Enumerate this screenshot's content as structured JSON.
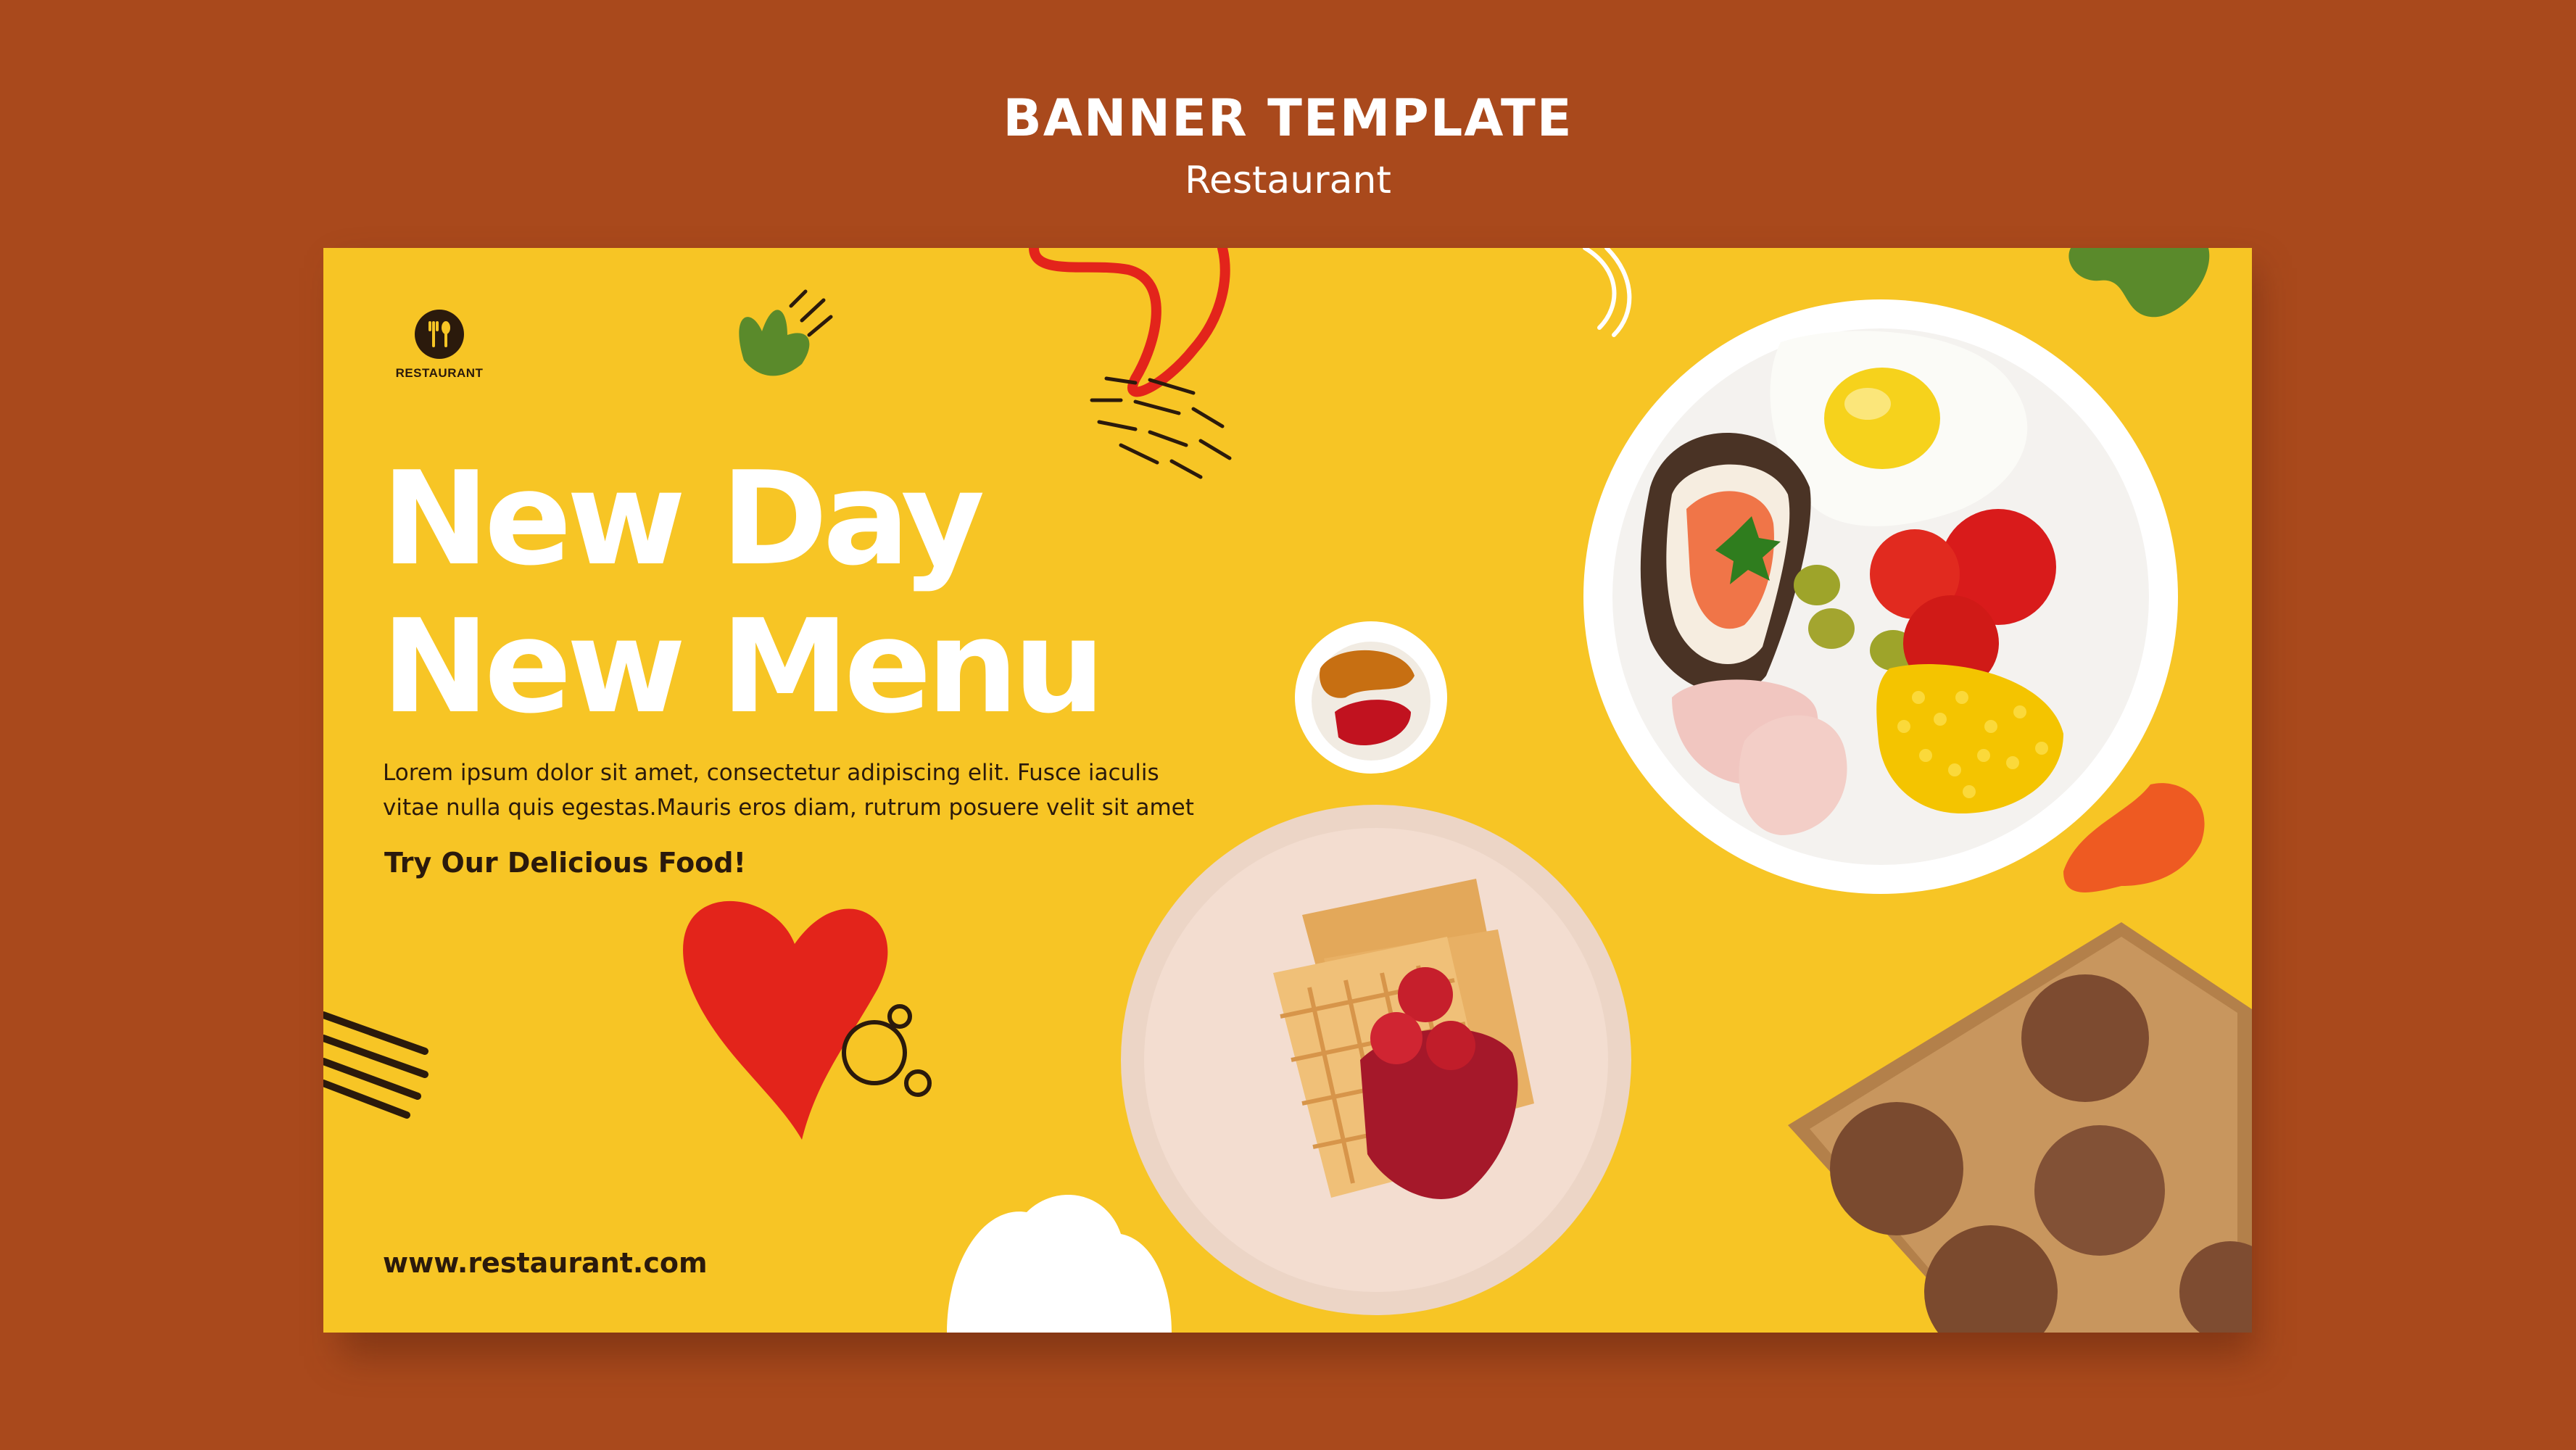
{
  "header": {
    "title": "BANNER TEMPLATE",
    "subtitle": "Restaurant"
  },
  "banner": {
    "logo_text": "RESTAURANT",
    "headline_line1": "New Day",
    "headline_line2": "New Menu",
    "body_line1": "Lorem ipsum dolor sit amet, consectetur adipiscing elit. Fusce iaculis",
    "body_line2": "vitae nulla quis egestas.Mauris eros diam, rutrum posuere velit sit amet",
    "cta": "Try Our Delicious Food!",
    "website": "www.restaurant.com"
  },
  "colors": {
    "page_background": "#a9491c",
    "banner_background": "#f7c525",
    "headline": "#ffffff",
    "text_dark": "#2b1a0c",
    "accent_red": "#e3241b",
    "accent_green": "#5a8a2b",
    "accent_orange": "#ee5a22"
  },
  "icons": {
    "logo": "fork-spoon-icon"
  }
}
